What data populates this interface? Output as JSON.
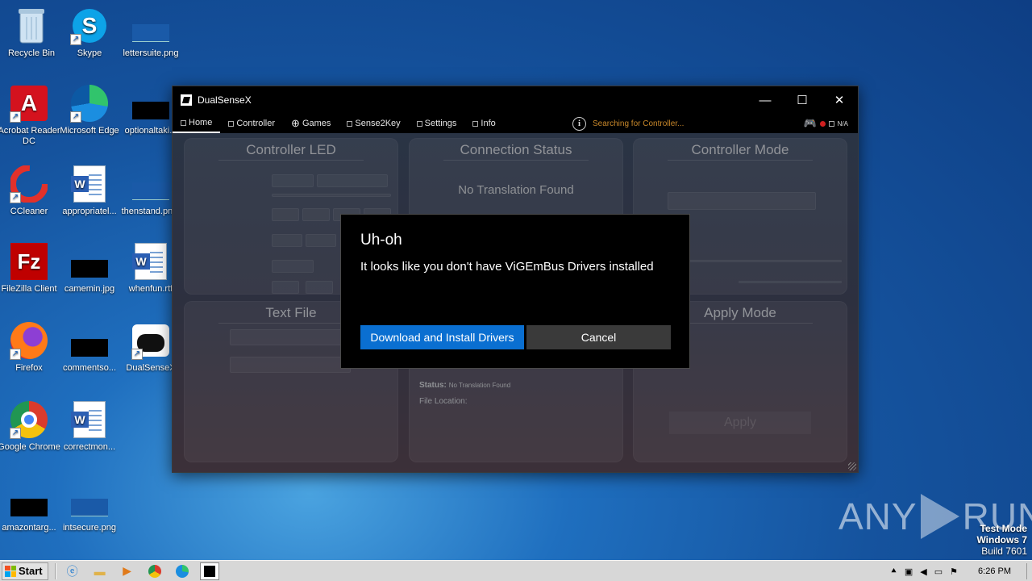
{
  "desktop": {
    "icons": [
      {
        "label": "Recycle Bin",
        "icon": "recycle-bin-icon"
      },
      {
        "label": "Skype",
        "icon": "skype-icon"
      },
      {
        "label": "lettersuite.png",
        "icon": "image-file-icon"
      },
      {
        "label": "Acrobat Reader DC",
        "icon": "acrobat-icon"
      },
      {
        "label": "Microsoft Edge",
        "icon": "edge-icon"
      },
      {
        "label": "optionaltaki...",
        "icon": "image-file-icon"
      },
      {
        "label": "CCleaner",
        "icon": "ccleaner-icon"
      },
      {
        "label": "appropriatel...",
        "icon": "word-doc-icon"
      },
      {
        "label": "thenstand.pn...",
        "icon": "image-file-icon"
      },
      {
        "label": "FileZilla Client",
        "icon": "filezilla-icon"
      },
      {
        "label": "camemin.jpg",
        "icon": "image-file-icon"
      },
      {
        "label": "whenfun.rtf",
        "icon": "word-doc-icon"
      },
      {
        "label": "Firefox",
        "icon": "firefox-icon"
      },
      {
        "label": "commentso...",
        "icon": "image-file-icon"
      },
      {
        "label": "DualSenseX",
        "icon": "dualsensex-icon"
      },
      {
        "label": "Google Chrome",
        "icon": "chrome-icon"
      },
      {
        "label": "correctmon...",
        "icon": "word-doc-icon"
      },
      {
        "label": "amazontarg...",
        "icon": "image-file-icon"
      },
      {
        "label": "intsecure.png",
        "icon": "image-file-icon"
      }
    ]
  },
  "window": {
    "title": "DualSenseX",
    "controls": {
      "minimize": "—",
      "maximize": "☐",
      "close": "✕"
    },
    "tabs": [
      {
        "label": "Home"
      },
      {
        "label": "Controller"
      },
      {
        "label": "Games"
      },
      {
        "label": "Sense2Key"
      },
      {
        "label": "Settings"
      },
      {
        "label": "Info"
      }
    ],
    "status_text": "Searching for Controller...",
    "battery_text": "N/A",
    "cards": {
      "controller_led": {
        "title": "Controller LED"
      },
      "connection_status": {
        "title": "Connection Status",
        "message": "No Translation Found"
      },
      "controller_mode": {
        "title": "Controller Mode"
      },
      "text_file": {
        "title": "Text File"
      },
      "apply_mode": {
        "title": "Apply Mode",
        "apply_label": "Apply"
      },
      "file_status": {
        "status_label": "Status:",
        "status_value": "No Translation Found",
        "location_label": "File Location:"
      }
    }
  },
  "dialog": {
    "title": "Uh-oh",
    "message": "It looks like you don't have ViGEmBus Drivers installed",
    "primary_button": "Download and Install Drivers",
    "cancel_button": "Cancel"
  },
  "watermark": {
    "text_left": "ANY",
    "text_right": "RUN"
  },
  "test_mode": {
    "line1": "Test Mode",
    "line2": "Windows 7",
    "line3": "Build 7601"
  },
  "taskbar": {
    "start_label": "Start",
    "clock": "6:26 PM"
  },
  "colors": {
    "accent": "#0a6fd1",
    "status_orange": "#c9882a",
    "alert_red": "#d01f1f"
  }
}
